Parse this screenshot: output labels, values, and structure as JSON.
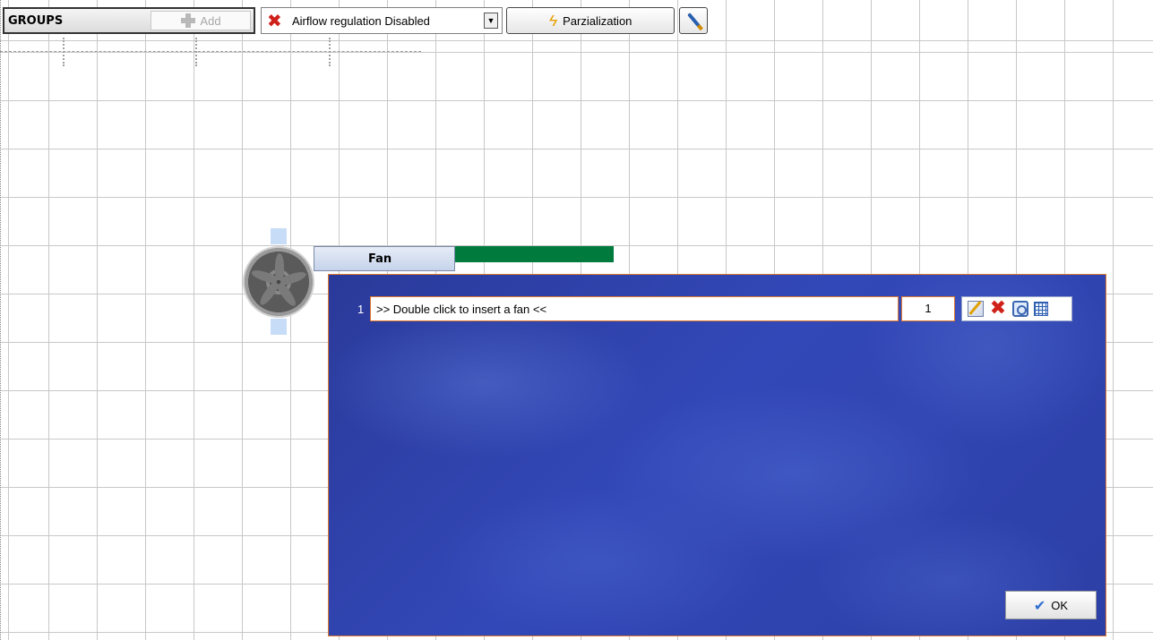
{
  "toolbar": {
    "groups_label": "GROUPS",
    "add_label": "Add",
    "airflow_value": "Airflow regulation Disabled",
    "parzialization_label": "Parzialization"
  },
  "fan_node": {
    "tab_label": "Fan"
  },
  "panel": {
    "row_number": "1",
    "fan_placeholder": ">> Double click to insert a fan <<",
    "quantity": "1",
    "ok_label": "OK"
  },
  "colors": {
    "panel_bg": "#3348b8",
    "panel_border": "#e07a30",
    "fan_bar": "#007a3d",
    "delete_red": "#d0201a"
  },
  "icons": [
    "plus-icon",
    "red-x-icon",
    "dropdown-arrow-icon",
    "lightning-icon",
    "brush-icon",
    "fan-icon",
    "edit-icon",
    "delete-icon",
    "search-icon",
    "grid-icon",
    "checkmark-icon"
  ]
}
